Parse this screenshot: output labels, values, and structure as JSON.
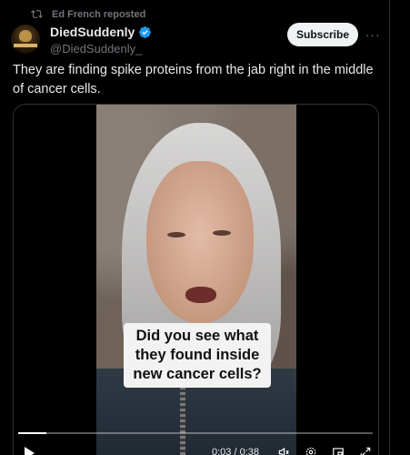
{
  "repost": {
    "text": "Ed French reposted"
  },
  "author": {
    "display_name": "DiedSuddenly",
    "handle": "@DiedSuddenly_",
    "avatar_banner": "DIED SUDDENLY"
  },
  "actions": {
    "subscribe_label": "Subscribe",
    "more_label": "···"
  },
  "tweet": {
    "text": "They are finding spike proteins from the jab right in the middle of cancer cells."
  },
  "video": {
    "caption": "Did you see what they found inside new cancer cells?",
    "time": "0:03 / 0:38",
    "progress": 0.08
  },
  "colors": {
    "verified": "#1d9bf0",
    "background": "#000000",
    "muted": "#71767b"
  },
  "icons": [
    "repost-icon",
    "verified-badge-icon",
    "more-icon",
    "play-icon",
    "volume-icon",
    "settings-icon",
    "expand-icon"
  ]
}
